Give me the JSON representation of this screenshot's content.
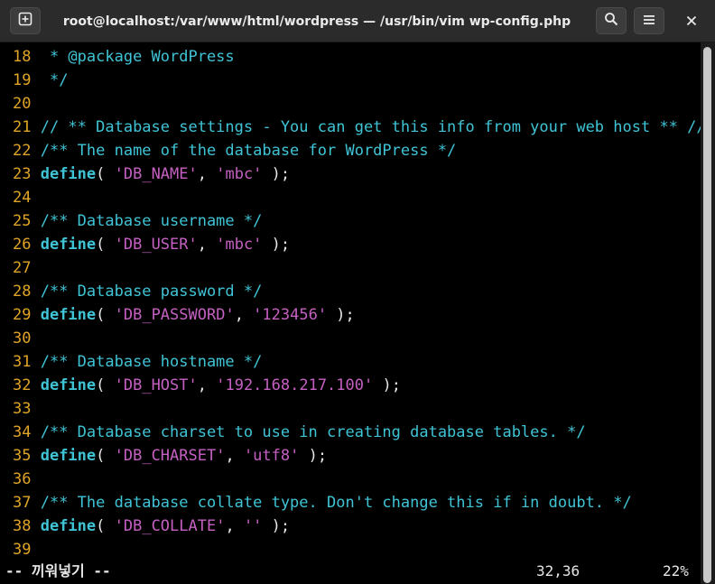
{
  "window": {
    "title": "root@localhost:/var/www/html/wordpress — /usr/bin/vim wp-config.php",
    "icons": {
      "new_tab": "new-tab-icon",
      "search": "search-icon",
      "menu": "hamburger-menu-icon",
      "close": "close-icon"
    }
  },
  "editor": {
    "colors": {
      "line_number": "#e0a526",
      "comment": "#3fc4d6",
      "keyword": "#3fc4d6",
      "string": "#c560c2",
      "plain": "#e6e6e6",
      "background": "#000000"
    },
    "lines": [
      {
        "num": "18",
        "segments": [
          {
            "t": " * @package WordPress",
            "c": "cm"
          }
        ]
      },
      {
        "num": "19",
        "segments": [
          {
            "t": " */",
            "c": "cm"
          }
        ]
      },
      {
        "num": "20",
        "segments": []
      },
      {
        "num": "21",
        "segments": [
          {
            "t": "// ** Database settings - You can get this info from your web host ** //",
            "c": "cm"
          }
        ]
      },
      {
        "num": "22",
        "segments": [
          {
            "t": "/** The name of the database for WordPress */",
            "c": "cm"
          }
        ]
      },
      {
        "num": "23",
        "segments": [
          {
            "t": "define",
            "c": "kw"
          },
          {
            "t": "( ",
            "c": "pl"
          },
          {
            "t": "'DB_NAME'",
            "c": "st"
          },
          {
            "t": ", ",
            "c": "pl"
          },
          {
            "t": "'mbc'",
            "c": "st"
          },
          {
            "t": " );",
            "c": "pl"
          }
        ]
      },
      {
        "num": "24",
        "segments": []
      },
      {
        "num": "25",
        "segments": [
          {
            "t": "/** Database username */",
            "c": "cm"
          }
        ]
      },
      {
        "num": "26",
        "segments": [
          {
            "t": "define",
            "c": "kw"
          },
          {
            "t": "( ",
            "c": "pl"
          },
          {
            "t": "'DB_USER'",
            "c": "st"
          },
          {
            "t": ", ",
            "c": "pl"
          },
          {
            "t": "'mbc'",
            "c": "st"
          },
          {
            "t": " );",
            "c": "pl"
          }
        ]
      },
      {
        "num": "27",
        "segments": []
      },
      {
        "num": "28",
        "segments": [
          {
            "t": "/** Database password */",
            "c": "cm"
          }
        ]
      },
      {
        "num": "29",
        "segments": [
          {
            "t": "define",
            "c": "kw"
          },
          {
            "t": "( ",
            "c": "pl"
          },
          {
            "t": "'DB_PASSWORD'",
            "c": "st"
          },
          {
            "t": ", ",
            "c": "pl"
          },
          {
            "t": "'123456'",
            "c": "st"
          },
          {
            "t": " );",
            "c": "pl"
          }
        ]
      },
      {
        "num": "30",
        "segments": []
      },
      {
        "num": "31",
        "segments": [
          {
            "t": "/** Database hostname */",
            "c": "cm"
          }
        ]
      },
      {
        "num": "32",
        "segments": [
          {
            "t": "define",
            "c": "kw"
          },
          {
            "t": "( ",
            "c": "pl"
          },
          {
            "t": "'DB_HOST'",
            "c": "st"
          },
          {
            "t": ", ",
            "c": "pl"
          },
          {
            "t": "'192.168.217.100'",
            "c": "st"
          },
          {
            "t": " );",
            "c": "pl"
          }
        ]
      },
      {
        "num": "33",
        "segments": []
      },
      {
        "num": "34",
        "segments": [
          {
            "t": "/** Database charset to use in creating database tables. */",
            "c": "cm"
          }
        ]
      },
      {
        "num": "35",
        "segments": [
          {
            "t": "define",
            "c": "kw"
          },
          {
            "t": "( ",
            "c": "pl"
          },
          {
            "t": "'DB_CHARSET'",
            "c": "st"
          },
          {
            "t": ", ",
            "c": "pl"
          },
          {
            "t": "'utf8'",
            "c": "st"
          },
          {
            "t": " );",
            "c": "pl"
          }
        ]
      },
      {
        "num": "36",
        "segments": []
      },
      {
        "num": "37",
        "segments": [
          {
            "t": "/** The database collate type. Don't change this if in doubt. */",
            "c": "cm"
          }
        ]
      },
      {
        "num": "38",
        "segments": [
          {
            "t": "define",
            "c": "kw"
          },
          {
            "t": "( ",
            "c": "pl"
          },
          {
            "t": "'DB_COLLATE'",
            "c": "st"
          },
          {
            "t": ", ",
            "c": "pl"
          },
          {
            "t": "''",
            "c": "st"
          },
          {
            "t": " );",
            "c": "pl"
          }
        ]
      },
      {
        "num": "39",
        "segments": []
      }
    ]
  },
  "status": {
    "mode": "-- 끼워넣기 --",
    "cursor": "32,36",
    "percent": "22%"
  },
  "scrollbar": {
    "position": 0.0
  }
}
